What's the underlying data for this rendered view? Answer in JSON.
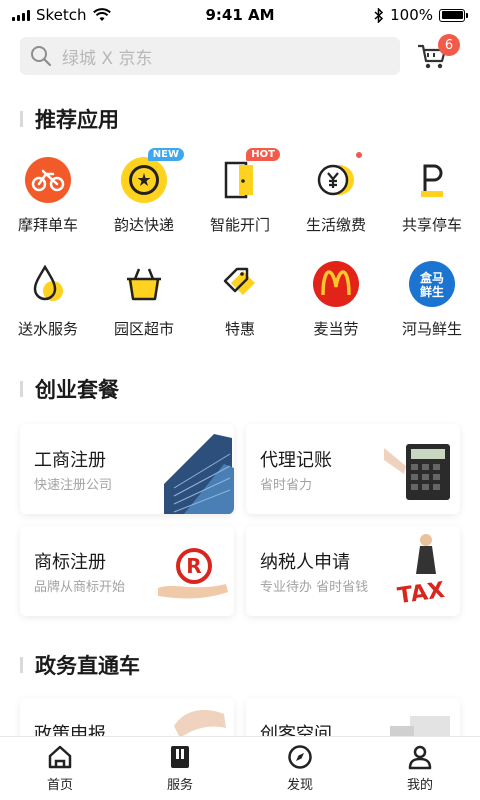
{
  "status_bar": {
    "carrier": "Sketch",
    "time": "9:41 AM",
    "battery": "100%"
  },
  "search": {
    "placeholder": "绿城 X 京东",
    "cart_count": "6"
  },
  "sections": {
    "recommended": "推荐应用",
    "startup": "创业套餐",
    "gov": "政务直通车"
  },
  "apps": [
    {
      "label": "摩拜单车",
      "icon": "bike-icon",
      "color": "#f25a2a"
    },
    {
      "label": "韵达快递",
      "icon": "yunda-icon",
      "badge": "NEW",
      "color": "#ffd21f"
    },
    {
      "label": "智能开门",
      "icon": "door-icon",
      "badge": "HOT",
      "color": "#ffd21f"
    },
    {
      "label": "生活缴费",
      "icon": "yen-coin-icon",
      "color": "#ffd21f"
    },
    {
      "label": "共享停车",
      "icon": "parking-icon",
      "color": "#ffd21f"
    },
    {
      "label": "送水服务",
      "icon": "water-drop-icon",
      "color": "#ffd21f"
    },
    {
      "label": "园区超市",
      "icon": "basket-icon",
      "color": "#ffd21f"
    },
    {
      "label": "特惠",
      "icon": "tag-icon",
      "color": "#ffd21f"
    },
    {
      "label": "麦当劳",
      "icon": "mcdonalds-icon",
      "color": "#e2231a"
    },
    {
      "label": "河马鲜生",
      "icon": "hema-icon",
      "color": "#1a74d0"
    }
  ],
  "cards": [
    {
      "title": "工商注册",
      "subtitle": "快速注册公司"
    },
    {
      "title": "代理记账",
      "subtitle": "省时省力"
    },
    {
      "title": "商标注册",
      "subtitle": "品牌从商标开始"
    },
    {
      "title": "纳税人申请",
      "subtitle": "专业待办 省时省钱"
    },
    {
      "title": "政策申报",
      "subtitle": ""
    },
    {
      "title": "创客空间",
      "subtitle": ""
    }
  ],
  "hema_text": [
    "盒马",
    "鲜生"
  ],
  "tabs": [
    {
      "label": "首页",
      "icon": "home-icon"
    },
    {
      "label": "服务",
      "icon": "service-icon"
    },
    {
      "label": "发现",
      "icon": "compass-icon"
    },
    {
      "label": "我的",
      "icon": "user-icon"
    }
  ]
}
